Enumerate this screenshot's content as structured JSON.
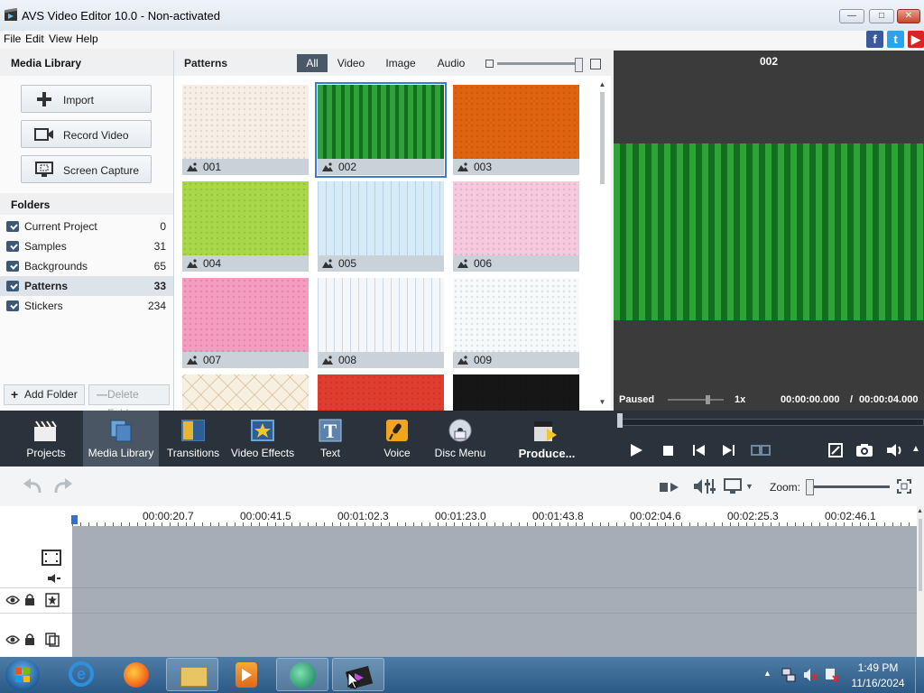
{
  "window": {
    "title": "AVS Video Editor 10.0 - Non-activated"
  },
  "menu": [
    "File",
    "Edit",
    "View",
    "Help"
  ],
  "media_library": {
    "title": "Media Library",
    "buttons": [
      "Import",
      "Record Video",
      "Screen Capture"
    ],
    "folders_title": "Folders",
    "folders": [
      {
        "name": "Current Project",
        "count": "0"
      },
      {
        "name": "Samples",
        "count": "31"
      },
      {
        "name": "Backgrounds",
        "count": "65"
      },
      {
        "name": "Patterns",
        "count": "33"
      },
      {
        "name": "Stickers",
        "count": "234"
      }
    ],
    "add_folder": "Add Folder",
    "delete_folder": "Delete Folder"
  },
  "patterns": {
    "title": "Patterns",
    "filters": [
      "All",
      "Video",
      "Image",
      "Audio"
    ],
    "active_filter": "All",
    "tiles": [
      {
        "label": "001",
        "color": "#f7efe6"
      },
      {
        "label": "002",
        "color": "#1f9a2e"
      },
      {
        "label": "003",
        "color": "#e0640f"
      },
      {
        "label": "004",
        "color": "#a8d84a"
      },
      {
        "label": "005",
        "color": "#d6ebf8"
      },
      {
        "label": "006",
        "color": "#f7c9df"
      },
      {
        "label": "007",
        "color": "#f59cc0"
      },
      {
        "label": "008",
        "color": "#f4f7fa"
      },
      {
        "label": "009",
        "color": "#f6fafb"
      },
      {
        "label": "",
        "color": "#f7efe0"
      },
      {
        "label": "",
        "color": "#e13d2f"
      },
      {
        "label": "",
        "color": "#161616"
      }
    ],
    "selected_index": 1
  },
  "preview": {
    "title": "002",
    "status": "Paused",
    "speed": "1x",
    "time_current": "00:00:00.000",
    "time_separator": "/",
    "time_total": "00:00:04.000"
  },
  "toolbar": {
    "items": [
      "Projects",
      "Media Library",
      "Transitions",
      "Video Effects",
      "Text",
      "Voice",
      "Disc Menu"
    ],
    "produce": "Produce...",
    "active": "Media Library"
  },
  "timeline": {
    "zoom_label": "Zoom:",
    "ticks": [
      "00:00:20.7",
      "00:00:41.5",
      "00:01:02.3",
      "00:01:23.0",
      "00:01:43.8",
      "00:02:04.6",
      "00:02:25.3",
      "00:02:46.1"
    ]
  },
  "taskbar": {
    "time": "1:49 PM",
    "date": "11/16/2024"
  }
}
